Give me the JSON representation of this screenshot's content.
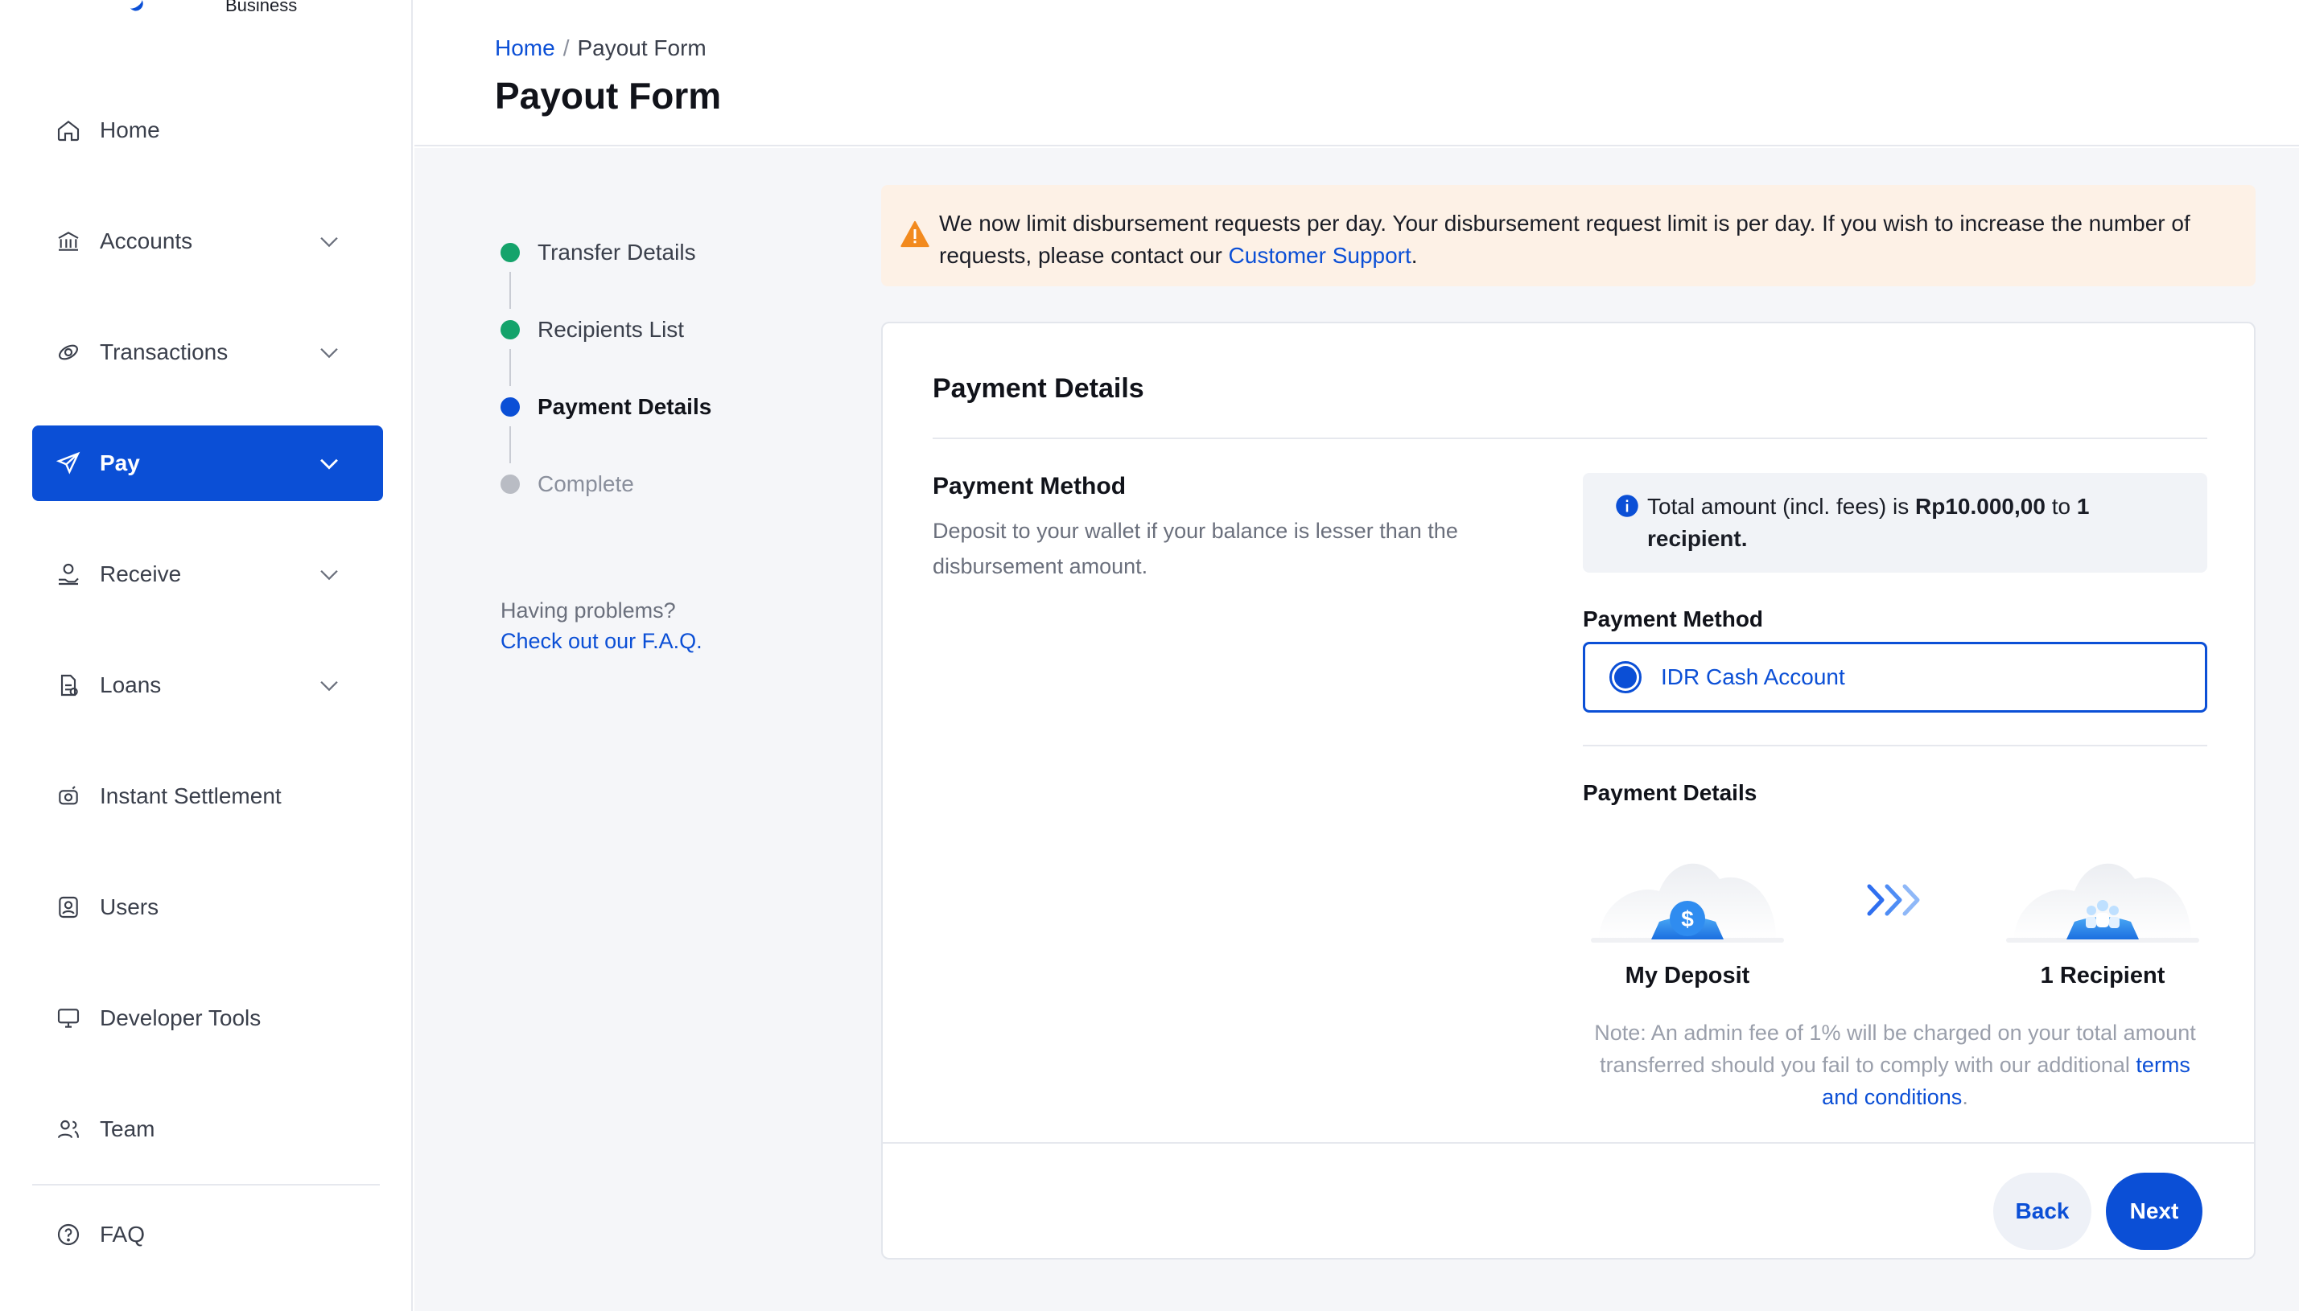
{
  "brand": {
    "subtitle": "Business"
  },
  "colors": {
    "primary": "#0b4fd6",
    "success": "#14a36b",
    "warning": "#f28a1e",
    "muted": "#b9bcc4"
  },
  "sidebar": {
    "items": [
      {
        "label": "Home",
        "icon": "home-icon",
        "has_chevron": false,
        "active": false
      },
      {
        "label": "Accounts",
        "icon": "bank-icon",
        "has_chevron": true,
        "active": false
      },
      {
        "label": "Transactions",
        "icon": "transactions-icon",
        "has_chevron": true,
        "active": false
      },
      {
        "label": "Pay",
        "icon": "send-icon",
        "has_chevron": true,
        "active": true
      },
      {
        "label": "Receive",
        "icon": "receive-icon",
        "has_chevron": true,
        "active": false
      },
      {
        "label": "Loans",
        "icon": "loans-icon",
        "has_chevron": true,
        "active": false
      },
      {
        "label": "Instant Settlement",
        "icon": "settlement-icon",
        "has_chevron": false,
        "active": false
      },
      {
        "label": "Users",
        "icon": "users-icon",
        "has_chevron": false,
        "active": false
      },
      {
        "label": "Developer Tools",
        "icon": "monitor-icon",
        "has_chevron": false,
        "active": false
      },
      {
        "label": "Team",
        "icon": "team-icon",
        "has_chevron": false,
        "active": false
      }
    ],
    "faq": {
      "label": "FAQ",
      "icon": "question-icon"
    }
  },
  "header": {
    "breadcrumb": {
      "home": "Home",
      "separator": "/",
      "current": "Payout Form"
    },
    "title": "Payout Form"
  },
  "stepper": {
    "steps": [
      {
        "label": "Transfer Details",
        "state": "done"
      },
      {
        "label": "Recipients List",
        "state": "done"
      },
      {
        "label": "Payment Details",
        "state": "current"
      },
      {
        "label": "Complete",
        "state": "todo"
      }
    ]
  },
  "help": {
    "question": "Having problems?",
    "link": "Check out our F.A.Q."
  },
  "alert": {
    "text": "We now limit disbursement requests per day. Your disbursement request limit is per day. If you wish to increase the number of requests, please contact our ",
    "link": "Customer Support",
    "suffix": "."
  },
  "card": {
    "title": "Payment Details",
    "payment_method": {
      "heading": "Payment Method",
      "description": "Deposit to your wallet if your balance is lesser than the disbursement amount."
    },
    "info": {
      "prefix": "Total amount (incl. fees) is ",
      "amount": "Rp10.000,00",
      "middle": " to ",
      "recipients": "1 recipient."
    },
    "method_label": "Payment Method",
    "method_option": "IDR Cash Account",
    "details_label": "Payment Details",
    "flow": {
      "from": "My Deposit",
      "to": "1 Recipient"
    },
    "note": {
      "text": "Note: An admin fee of 1% will be charged on your total amount transferred should you fail to comply with our additional ",
      "link": "terms and conditions",
      "suffix": "."
    },
    "buttons": {
      "back": "Back",
      "next": "Next"
    }
  }
}
